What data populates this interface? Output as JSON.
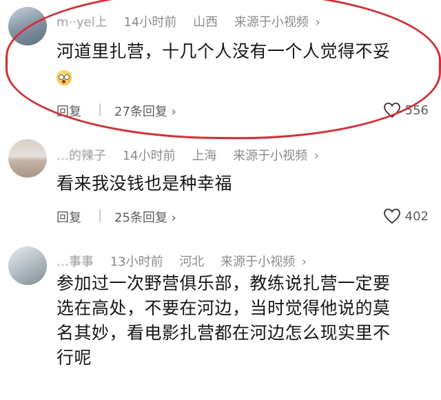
{
  "comments": [
    {
      "user": "m··yel上",
      "time": "14小时前",
      "location": "山西",
      "source": "来源于小视频",
      "source_arrow": "›",
      "text": "河道里扎营，十几个人没有一个人觉得不妥",
      "reply_label": "回复",
      "separator": "|",
      "replies": "27条回复",
      "replies_arrow": "›",
      "likes": "556"
    },
    {
      "user": "…的辣子",
      "time": "14小时前",
      "location": "上海",
      "source": "来源于小视频",
      "source_arrow": "›",
      "text": "看来我没钱也是种幸福",
      "reply_label": "回复",
      "separator": "|",
      "replies": "25条回复",
      "replies_arrow": "›",
      "likes": "402"
    },
    {
      "user": "…事事",
      "time": "13小时前",
      "location": "河北",
      "source": "来源于小视频",
      "source_arrow": "›",
      "text_lines": [
        "参加过一次野营俱乐部，教练说扎营一定要",
        "选在高处，不要在河边，当时觉得他说的莫",
        "名其妙，看电影扎营都在河边怎么现实里不",
        "行呢"
      ]
    }
  ],
  "colors": {
    "highlight": "#e3262b",
    "meta": "#8a8a8a"
  },
  "icons": [
    "heart-icon",
    "emoji-icon",
    "chevron-right-icon"
  ]
}
